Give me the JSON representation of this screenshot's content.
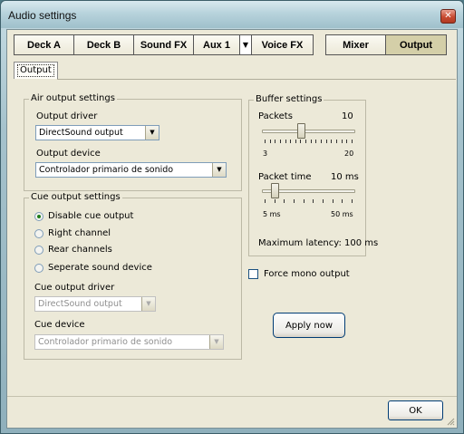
{
  "window": {
    "title": "Audio settings"
  },
  "toolbar": {
    "left_tabs": [
      "Deck A",
      "Deck B",
      "Sound FX",
      "Aux 1",
      "Voice FX"
    ],
    "right_tabs": [
      "Mixer",
      "Output"
    ],
    "active": "Output"
  },
  "subtab": {
    "label": "Output"
  },
  "air_output": {
    "title": "Air output settings",
    "driver_label": "Output driver",
    "driver_value": "DirectSound output",
    "device_label": "Output device",
    "device_value": "Controlador primario de sonido"
  },
  "cue_output": {
    "title": "Cue output settings",
    "options": [
      "Disable cue output",
      "Right channel",
      "Rear channels",
      "Seperate sound device"
    ],
    "selected_index": 0,
    "driver_label": "Cue output driver",
    "driver_value": "DirectSound output",
    "device_label": "Cue device",
    "device_value": "Controlador primario de sonido"
  },
  "buffer": {
    "title": "Buffer settings",
    "packets_label": "Packets",
    "packets_value": "10",
    "packets_min": "3",
    "packets_max": "20",
    "packets_level": 0.41,
    "packet_time_label": "Packet time",
    "packet_time_value": "10 ms",
    "packet_time_min": "5 ms",
    "packet_time_max": "50 ms",
    "packet_time_level": 0.11,
    "latency_text": "Maximum latency: 100 ms"
  },
  "force_mono": {
    "label": "Force mono output",
    "checked": false
  },
  "apply_button": "Apply now",
  "ok_button": "OK",
  "icons": {
    "close": "close-icon",
    "dropdown": "chevron-down-icon"
  }
}
